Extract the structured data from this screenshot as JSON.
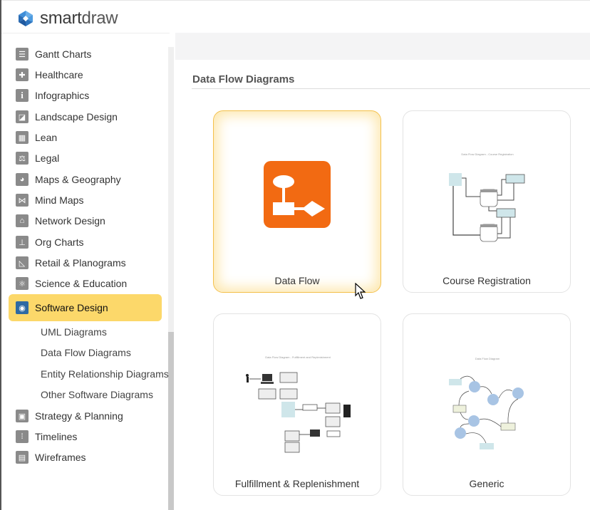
{
  "app": {
    "logo_text_bold": "smart",
    "logo_text_light": "draw"
  },
  "sidebar": {
    "items": [
      {
        "label": "Gantt Charts",
        "icon": "gantt-icon"
      },
      {
        "label": "Healthcare",
        "icon": "healthcare-icon"
      },
      {
        "label": "Infographics",
        "icon": "info-icon"
      },
      {
        "label": "Landscape Design",
        "icon": "landscape-icon"
      },
      {
        "label": "Lean",
        "icon": "lean-icon"
      },
      {
        "label": "Legal",
        "icon": "scales-icon"
      },
      {
        "label": "Maps & Geography",
        "icon": "globe-icon"
      },
      {
        "label": "Mind Maps",
        "icon": "mind-map-icon"
      },
      {
        "label": "Network Design",
        "icon": "network-icon"
      },
      {
        "label": "Org Charts",
        "icon": "org-chart-icon"
      },
      {
        "label": "Retail & Planograms",
        "icon": "retail-icon"
      },
      {
        "label": "Science & Education",
        "icon": "atom-icon"
      },
      {
        "label": "Software Design",
        "icon": "software-disc-icon",
        "active": true
      },
      {
        "label": "Strategy & Planning",
        "icon": "strategy-icon"
      },
      {
        "label": "Timelines",
        "icon": "timeline-icon"
      },
      {
        "label": "Wireframes",
        "icon": "wireframe-icon"
      }
    ],
    "sub_items": [
      {
        "label": "UML Diagrams"
      },
      {
        "label": "Data Flow Diagrams"
      },
      {
        "label": "Entity Relationship Diagrams"
      },
      {
        "label": "Other Software Diagrams"
      }
    ]
  },
  "main": {
    "section_title": "Data Flow Diagrams",
    "cards": [
      {
        "label": "Data Flow",
        "selected": true,
        "kind": "blank-template"
      },
      {
        "label": "Course Registration",
        "selected": false,
        "thumb_title": "Data Flow Diagram - Course Registration"
      },
      {
        "label": "Fulfillment & Replenishment",
        "selected": false,
        "thumb_title": "Data Flow Diagram - Fulfillment and Replenishment"
      },
      {
        "label": "Generic",
        "selected": false,
        "thumb_title": "Data Flow Diagram"
      }
    ]
  },
  "colors": {
    "accent_active": "#fcd86a",
    "template_orange": "#f26a12",
    "selected_border": "#f4c04a"
  }
}
